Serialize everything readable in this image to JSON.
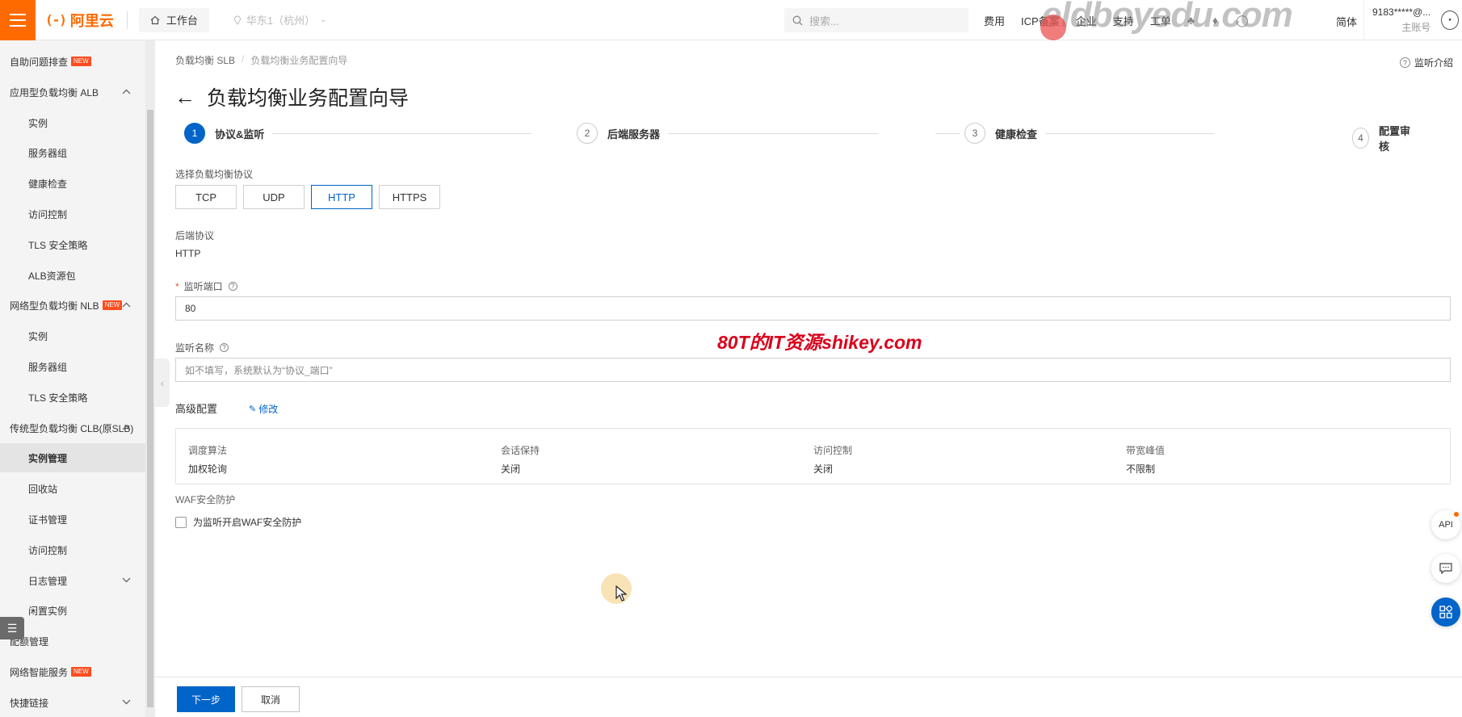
{
  "topbar": {
    "logo_text": "阿里云",
    "logo_mark": "(-)",
    "workbench": "工作台",
    "region": "华东1（杭州）",
    "search_placeholder": "搜索...",
    "links": [
      "费用",
      "ICP备案",
      "企业",
      "支持",
      "工单"
    ],
    "lang": "简体",
    "account_name": "9183*****@...",
    "account_role": "主账号",
    "watermark": "eldboyedu.com"
  },
  "sidebar": {
    "items": [
      {
        "label": "自助问题排查",
        "level": "top",
        "new": true,
        "chevron": ""
      },
      {
        "label": "应用型负载均衡 ALB",
        "level": "top",
        "new": false,
        "chevron": "up"
      },
      {
        "label": "实例",
        "level": "sub"
      },
      {
        "label": "服务器组",
        "level": "sub"
      },
      {
        "label": "健康检查",
        "level": "sub"
      },
      {
        "label": "访问控制",
        "level": "sub"
      },
      {
        "label": "TLS 安全策略",
        "level": "sub"
      },
      {
        "label": "ALB资源包",
        "level": "sub"
      },
      {
        "label": "网络型负载均衡 NLB",
        "level": "top",
        "new": true,
        "chevron": "up"
      },
      {
        "label": "实例",
        "level": "sub"
      },
      {
        "label": "服务器组",
        "level": "sub"
      },
      {
        "label": "TLS 安全策略",
        "level": "sub"
      },
      {
        "label": "传统型负载均衡 CLB(原SLB)",
        "level": "top",
        "new": false,
        "chevron": "up"
      },
      {
        "label": "实例管理",
        "level": "sub",
        "active": true
      },
      {
        "label": "回收站",
        "level": "sub"
      },
      {
        "label": "证书管理",
        "level": "sub"
      },
      {
        "label": "访问控制",
        "level": "sub"
      },
      {
        "label": "日志管理",
        "level": "sub",
        "chevron": "down"
      },
      {
        "label": "闲置实例",
        "level": "sub"
      },
      {
        "label": "配额管理",
        "level": "top"
      },
      {
        "label": "网络智能服务",
        "level": "top",
        "new": true
      },
      {
        "label": "快捷链接",
        "level": "top",
        "chevron": "down"
      }
    ],
    "new_tag": "NEW"
  },
  "breadcrumb": {
    "root": "负载均衡 SLB",
    "current": "负载均衡业务配置向导"
  },
  "help_intro": "监听介绍",
  "page_title": "负载均衡业务配置向导",
  "steps": [
    {
      "num": "1",
      "label": "协议&监听",
      "active": true
    },
    {
      "num": "2",
      "label": "后端服务器",
      "active": false
    },
    {
      "num": "3",
      "label": "健康检查",
      "active": false
    },
    {
      "num": "4",
      "label": "配置审核",
      "active": false
    }
  ],
  "form": {
    "protocol_label": "选择负载均衡协议",
    "protocols": [
      "TCP",
      "UDP",
      "HTTP",
      "HTTPS"
    ],
    "selected_protocol": "HTTP",
    "backend_label": "后端协议",
    "backend_value": "HTTP",
    "port_label": "监听端口",
    "port_value": "80",
    "name_label": "监听名称",
    "name_placeholder": "如不填写，系统默认为“协议_端口”",
    "advanced_title": "高级配置",
    "edit_link": "修改",
    "advanced": [
      {
        "key": "调度算法",
        "value": "加权轮询"
      },
      {
        "key": "会话保持",
        "value": "关闭"
      },
      {
        "key": "访问控制",
        "value": "关闭"
      },
      {
        "key": "带宽峰值",
        "value": "不限制"
      }
    ],
    "waf_title": "WAF安全防护",
    "waf_checkbox": "为监听开启WAF安全防护",
    "waf_checked": false
  },
  "banner": "80T的IT资源shikey.com",
  "floats": {
    "api": "API"
  },
  "footer": {
    "next": "下一步",
    "cancel": "取消"
  }
}
